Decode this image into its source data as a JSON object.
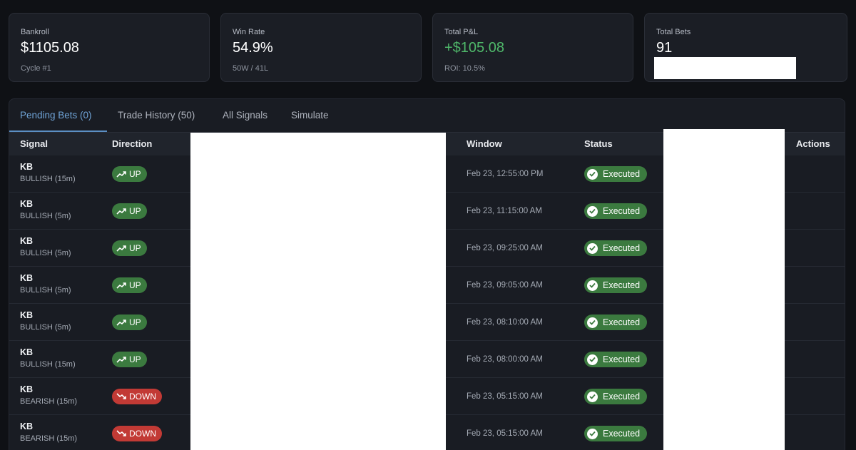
{
  "stats": [
    {
      "label": "Bankroll",
      "value": "$1105.08",
      "sub": "Cycle #1"
    },
    {
      "label": "Win Rate",
      "value": "54.9%",
      "sub": "50W / 41L"
    },
    {
      "label": "Total P&L",
      "value": "+$105.08",
      "sub": "ROI: 10.5%"
    },
    {
      "label": "Total Bets",
      "value": "91"
    }
  ],
  "tabs": [
    "Pending Bets (0)",
    "Trade History (50)",
    "All Signals",
    "Simulate"
  ],
  "columns": {
    "signal": "Signal",
    "direction": "Direction",
    "window": "Window",
    "status": "Status",
    "actions": "Actions"
  },
  "rows": [
    {
      "signal": "KB",
      "detail": "BULLISH (15m)",
      "direction": "UP",
      "window": "Feb 23, 12:55:00 PM",
      "status": "Executed"
    },
    {
      "signal": "KB",
      "detail": "BULLISH (5m)",
      "direction": "UP",
      "window": "Feb 23, 11:15:00 AM",
      "status": "Executed"
    },
    {
      "signal": "KB",
      "detail": "BULLISH (5m)",
      "direction": "UP",
      "window": "Feb 23, 09:25:00 AM",
      "status": "Executed"
    },
    {
      "signal": "KB",
      "detail": "BULLISH (5m)",
      "direction": "UP",
      "window": "Feb 23, 09:05:00 AM",
      "status": "Executed"
    },
    {
      "signal": "KB",
      "detail": "BULLISH (5m)",
      "direction": "UP",
      "window": "Feb 23, 08:10:00 AM",
      "status": "Executed"
    },
    {
      "signal": "KB",
      "detail": "BULLISH (15m)",
      "direction": "UP",
      "window": "Feb 23, 08:00:00 AM",
      "status": "Executed"
    },
    {
      "signal": "KB",
      "detail": "BEARISH (15m)",
      "direction": "DOWN",
      "window": "Feb 23, 05:15:00 AM",
      "status": "Executed"
    },
    {
      "signal": "KB",
      "detail": "BEARISH (15m)",
      "direction": "DOWN",
      "window": "Feb 23, 05:15:00 AM",
      "status": "Executed"
    }
  ],
  "icons": {
    "up": "trending-up-icon",
    "down": "trending-down-icon",
    "status": "check-circle-icon"
  },
  "colors": {
    "positive": "#4fb86a",
    "up_badge": "#3b7a3f",
    "down_badge": "#c23a35",
    "active_tab": "#6fa3d6"
  }
}
